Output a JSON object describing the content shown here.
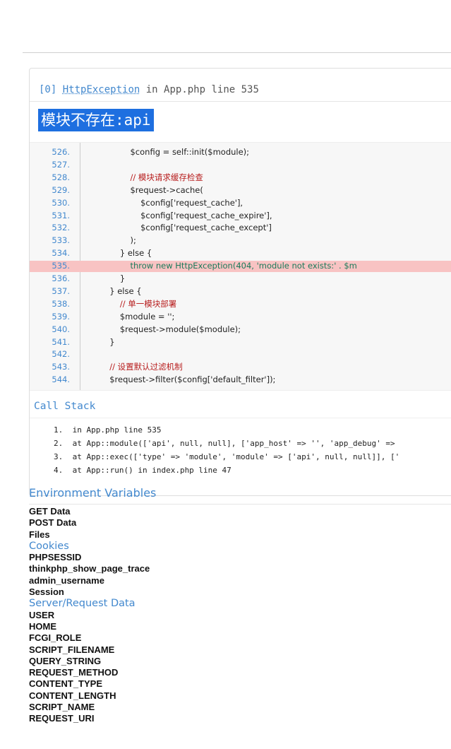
{
  "exception": {
    "index": "[0]",
    "class": "HttpException",
    "location": "in App.php line 535",
    "message": "模块不存在:api"
  },
  "source_lines": [
    {
      "n": "526.",
      "code": "                $config = self::init($module);",
      "hl": false
    },
    {
      "n": "527.",
      "code": "",
      "hl": false
    },
    {
      "n": "528.",
      "code": "                // 模块请求缓存检查",
      "hl": false,
      "comment": true
    },
    {
      "n": "529.",
      "code": "                $request->cache(",
      "hl": false
    },
    {
      "n": "530.",
      "code": "                    $config['request_cache'],",
      "hl": false
    },
    {
      "n": "531.",
      "code": "                    $config['request_cache_expire'],",
      "hl": false
    },
    {
      "n": "532.",
      "code": "                    $config['request_cache_except']",
      "hl": false
    },
    {
      "n": "533.",
      "code": "                );",
      "hl": false
    },
    {
      "n": "534.",
      "code": "            } else {",
      "hl": false
    },
    {
      "n": "535.",
      "code": "                throw new HttpException(404, 'module not exists:' . $m",
      "hl": true
    },
    {
      "n": "536.",
      "code": "            }",
      "hl": false
    },
    {
      "n": "537.",
      "code": "        } else {",
      "hl": false
    },
    {
      "n": "538.",
      "code": "            // 单一模块部署",
      "hl": false,
      "comment": true
    },
    {
      "n": "539.",
      "code": "            $module = '';",
      "hl": false
    },
    {
      "n": "540.",
      "code": "            $request->module($module);",
      "hl": false
    },
    {
      "n": "541.",
      "code": "        }",
      "hl": false
    },
    {
      "n": "542.",
      "code": "",
      "hl": false
    },
    {
      "n": "543.",
      "code": "        // 设置默认过滤机制",
      "hl": false,
      "comment": true
    },
    {
      "n": "544.",
      "code": "        $request->filter($config['default_filter']);",
      "hl": false
    }
  ],
  "call_stack": {
    "title": "Call Stack",
    "items": [
      {
        "num": "1.",
        "text": "in App.php line 535"
      },
      {
        "num": "2.",
        "text": "at App::module(['api', null, null], ['app_host' => '', 'app_debug' =>"
      },
      {
        "num": "3.",
        "text": "at App::exec(['type' => 'module', 'module' => ['api', null, null]], ['"
      },
      {
        "num": "4.",
        "text": "at App::run() in index.php line 47"
      }
    ]
  },
  "environment": {
    "title": "Environment Variables",
    "items": [
      {
        "label": "GET Data",
        "section": false
      },
      {
        "label": "POST Data",
        "section": false
      },
      {
        "label": "Files",
        "section": false
      },
      {
        "label": "Cookies",
        "section": true
      },
      {
        "label": "PHPSESSID",
        "section": false
      },
      {
        "label": "thinkphp_show_page_trace",
        "section": false
      },
      {
        "label": "admin_username",
        "section": false
      },
      {
        "label": "Session",
        "section": false
      },
      {
        "label": "Server/Request Data",
        "section": true
      },
      {
        "label": "USER",
        "section": false
      },
      {
        "label": "HOME",
        "section": false
      },
      {
        "label": "FCGI_ROLE",
        "section": false
      },
      {
        "label": "SCRIPT_FILENAME",
        "section": false
      },
      {
        "label": "QUERY_STRING",
        "section": false
      },
      {
        "label": "REQUEST_METHOD",
        "section": false
      },
      {
        "label": "CONTENT_TYPE",
        "section": false
      },
      {
        "label": "CONTENT_LENGTH",
        "section": false
      },
      {
        "label": "SCRIPT_NAME",
        "section": false
      },
      {
        "label": "REQUEST_URI",
        "section": false
      }
    ]
  },
  "colors": {
    "accent": "#4288ce",
    "title_bg": "#1e6fe0",
    "highlight": "#f8c3c3"
  }
}
